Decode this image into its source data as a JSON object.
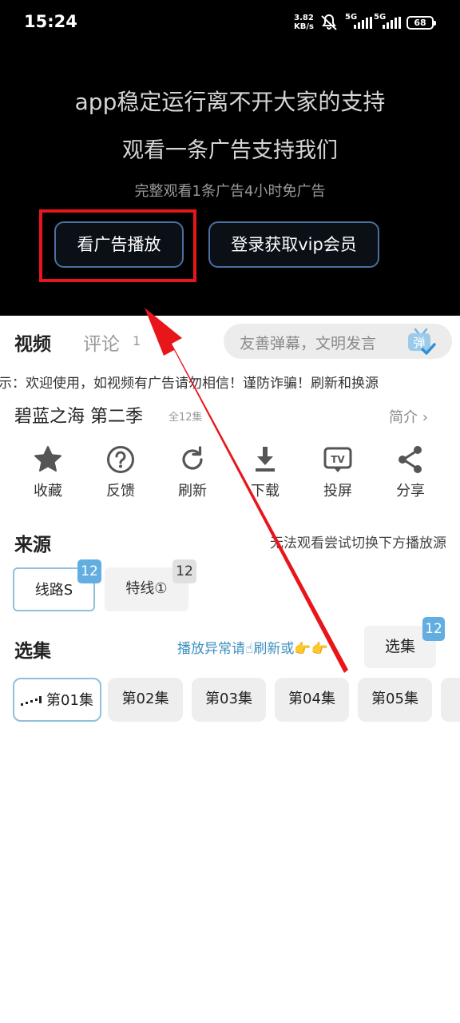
{
  "status_bar": {
    "time": "15:24",
    "net_speed_value": "3.82",
    "net_speed_unit": "KB/s",
    "signal1_label": "5G",
    "signal2_label": "5G",
    "battery": "68"
  },
  "ad": {
    "line1": "app稳定运行离不开大家的支持",
    "line2": "观看一条广告支持我们",
    "subtitle": "完整观看1条广告4小时免广告",
    "watch_button": "看广告播放",
    "vip_button": "登录获取vip会员"
  },
  "tabs": {
    "video": "视频",
    "comment": "评论",
    "comment_count": "1"
  },
  "danmu": {
    "placeholder": "友善弹幕，文明发言",
    "icon_char": "弹"
  },
  "notice": "示：欢迎使用，如视频有广告请勿相信！谨防诈骗！刷新和换源",
  "show": {
    "title": "碧蓝之海 第二季",
    "total": "全12集",
    "intro": "简介 ›"
  },
  "actions": [
    {
      "label": "收藏",
      "icon": "star-icon"
    },
    {
      "label": "反馈",
      "icon": "question-icon"
    },
    {
      "label": "刷新",
      "icon": "refresh-icon"
    },
    {
      "label": "下载",
      "icon": "download-icon"
    },
    {
      "label": "投屏",
      "icon": "tv-cast-icon"
    },
    {
      "label": "分享",
      "icon": "share-icon"
    }
  ],
  "source": {
    "title": "来源",
    "hint": "无法观看尝试切换下方播放源",
    "routes": [
      {
        "label": "线路S",
        "count": "12"
      },
      {
        "label": "特线①",
        "count": "12"
      }
    ]
  },
  "episodes": {
    "title": "选集",
    "hint": "播放异常请☝刷新或👉👉",
    "select_button": "选集",
    "select_badge": "12",
    "items": [
      "第01集",
      "第02集",
      "第03集",
      "第04集",
      "第05集"
    ]
  },
  "colors": {
    "accent_blue": "#63aee0",
    "highlight_red": "#e8151b",
    "border_blue": "#8fc0dc"
  }
}
